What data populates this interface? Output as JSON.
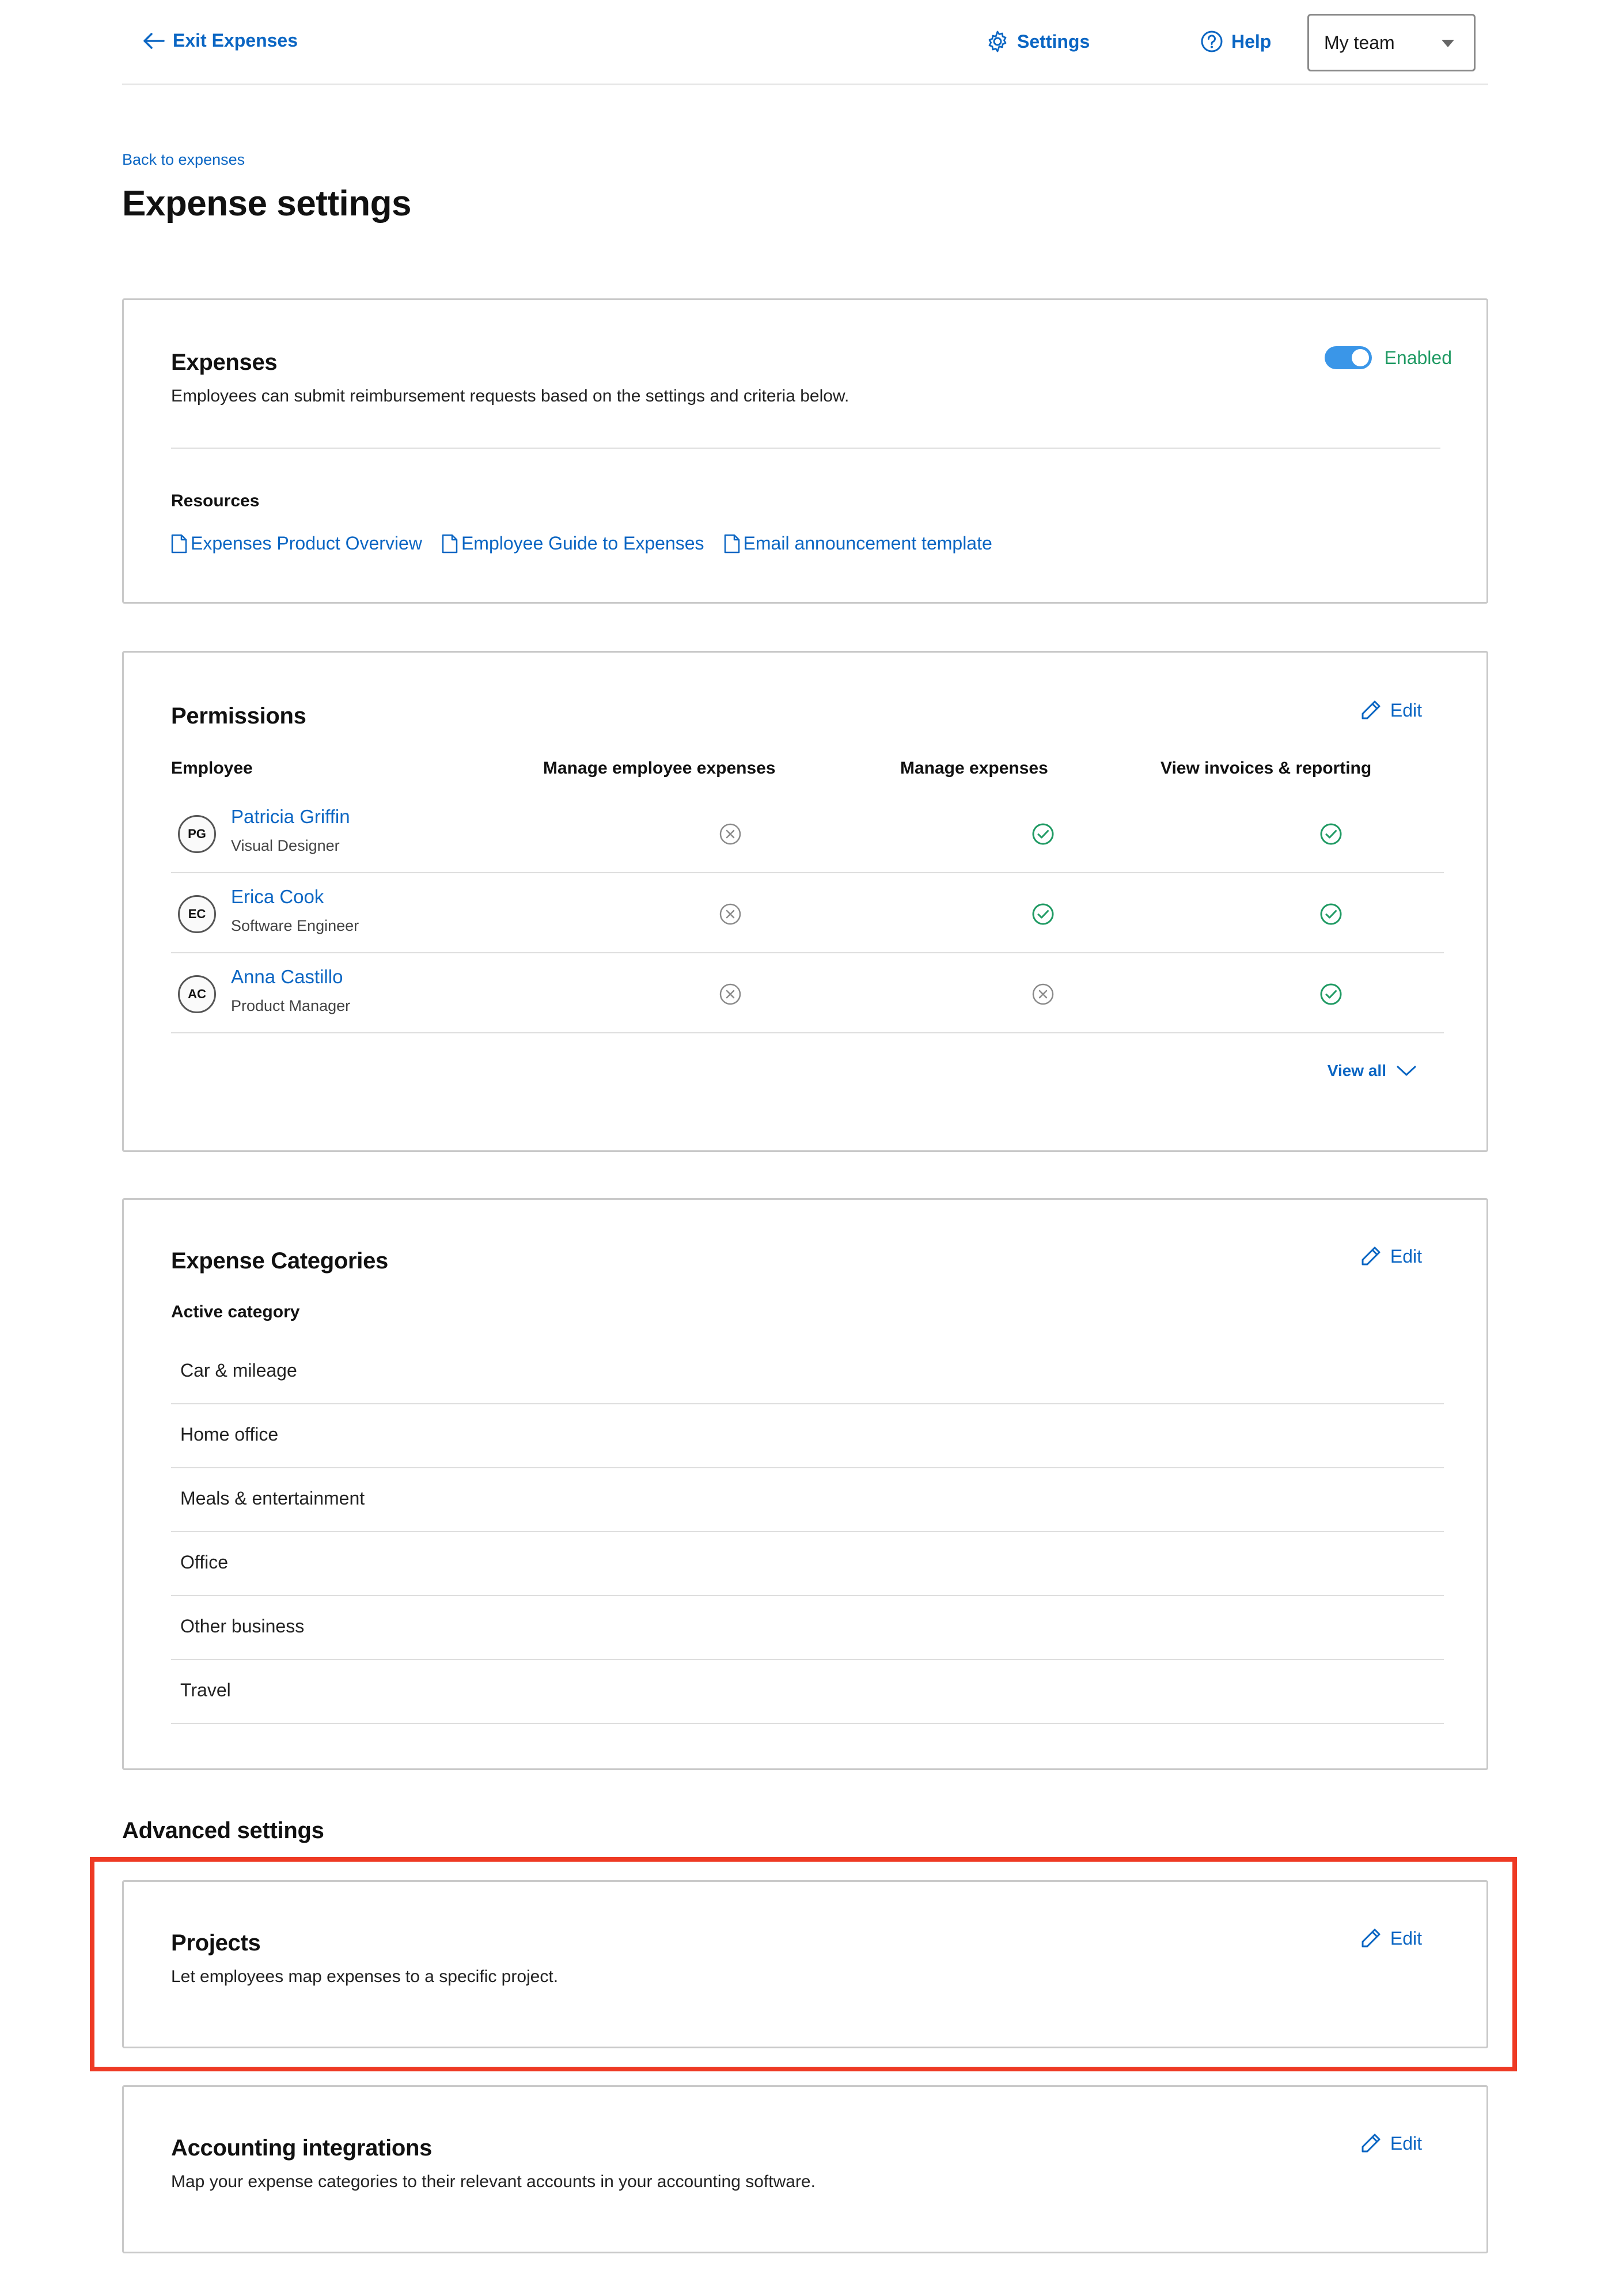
{
  "header": {
    "exit_label": "Exit Expenses",
    "settings_label": "Settings",
    "help_label": "Help",
    "team_select_value": "My team"
  },
  "page": {
    "back_link": "Back to expenses",
    "title": "Expense settings"
  },
  "expenses_card": {
    "title": "Expenses",
    "description": "Employees can submit reimbursement requests based on the settings and criteria below.",
    "toggle_label": "Enabled",
    "toggle_on": true,
    "resources_title": "Resources",
    "resources": [
      "Expenses Product Overview",
      "Employee Guide to Expenses",
      "Email announcement template"
    ]
  },
  "permissions_card": {
    "title": "Permissions",
    "edit_label": "Edit",
    "columns": [
      "Employee",
      "Manage employee expenses",
      "Manage expenses",
      "View invoices & reporting"
    ],
    "rows": [
      {
        "initials": "PG",
        "name": "Patricia Griffin",
        "role": "Visual Designer",
        "perms": [
          false,
          true,
          true
        ]
      },
      {
        "initials": "EC",
        "name": "Erica Cook",
        "role": "Software Engineer",
        "perms": [
          false,
          true,
          true
        ]
      },
      {
        "initials": "AC",
        "name": "Anna Castillo",
        "role": "Product Manager",
        "perms": [
          false,
          false,
          true
        ]
      }
    ],
    "view_all_label": "View all"
  },
  "categories_card": {
    "title": "Expense Categories",
    "edit_label": "Edit",
    "subtitle": "Active category",
    "items": [
      "Car & mileage",
      "Home office",
      "Meals & entertainment",
      "Office",
      "Other business",
      "Travel"
    ]
  },
  "advanced": {
    "title": "Advanced settings",
    "projects": {
      "title": "Projects",
      "description": "Let employees map expenses to a specific project.",
      "edit_label": "Edit"
    },
    "accounting": {
      "title": "Accounting integrations",
      "description": "Map your expense categories to their relevant accounts in your accounting software.",
      "edit_label": "Edit"
    }
  },
  "colors": {
    "link": "#0b66c3",
    "success": "#1f9a63",
    "toggle": "#3a96e8",
    "highlight": "#ee3a24"
  }
}
